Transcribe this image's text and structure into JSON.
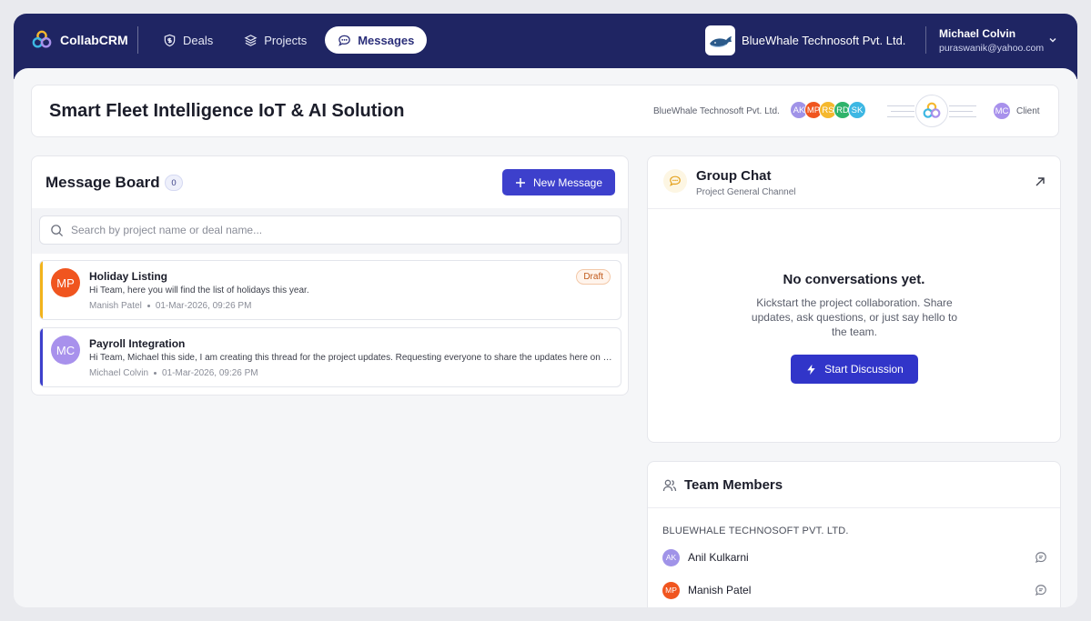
{
  "app": {
    "name": "CollabCRM"
  },
  "nav": {
    "deals": "Deals",
    "projects": "Projects",
    "messages": "Messages"
  },
  "company": {
    "name": "BlueWhale Technosoft Pvt. Ltd."
  },
  "user": {
    "name": "Michael Colvin",
    "email": "puraswanik@yahoo.com"
  },
  "project": {
    "title": "Smart Fleet Intelligence IoT & AI Solution",
    "company": "BlueWhale Technosoft Pvt. Ltd.",
    "avatars": [
      {
        "initials": "AK",
        "color": "#a093e8"
      },
      {
        "initials": "MP",
        "color": "#f0551f"
      },
      {
        "initials": "RS",
        "color": "#f5b82e"
      },
      {
        "initials": "RD",
        "color": "#2fb36b"
      },
      {
        "initials": "SK",
        "color": "#3db7e3"
      }
    ],
    "client": {
      "initials": "MC",
      "label": "Client",
      "color": "#a891ec"
    }
  },
  "board": {
    "title": "Message Board",
    "count": "0",
    "new_message_label": "New Message",
    "search_placeholder": "Search by project name or deal name...",
    "messages": [
      {
        "initials": "MP",
        "avatar_color": "#f0551f",
        "stripe_color": "#f2b31b",
        "title": "Holiday Listing",
        "body": "Hi Team, here you will find the list of holidays this year.",
        "author": "Manish Patel",
        "date": "01-Mar-2026, 09:26 PM",
        "badge": "Draft"
      },
      {
        "initials": "MC",
        "avatar_color": "#a891ec",
        "stripe_color": "#3d40cc",
        "title": "Payroll Integration",
        "body": "Hi Team, Michael this side, I am creating this thread for the project updates. Requesting everyone to share the updates here on a regular basis.",
        "author": "Michael Colvin",
        "date": "01-Mar-2026, 09:26 PM",
        "badge": ""
      }
    ]
  },
  "chat": {
    "title": "Group Chat",
    "subtitle": "Project General Channel",
    "empty_title": "No conversations yet.",
    "empty_desc": "Kickstart the project collaboration. Share updates, ask questions, or just say hello to the team.",
    "start_label": "Start Discussion"
  },
  "team": {
    "title": "Team Members",
    "org": "BLUEWHALE TECHNOSOFT PVT. LTD.",
    "members": [
      {
        "initials": "AK",
        "name": "Anil Kulkarni",
        "color": "#a093e8"
      },
      {
        "initials": "MP",
        "name": "Manish Patel",
        "color": "#f0551f"
      }
    ]
  },
  "icons": {
    "logo": "collabcrm-logo-icon",
    "deals": "shield-dollar-icon",
    "projects": "layers-icon",
    "messages": "chat-bubble-icon",
    "search": "search-icon",
    "plus": "plus-icon",
    "expand": "arrow-up-right-icon",
    "bolt": "bolt-icon",
    "team": "users-icon",
    "chevron": "chevron-down-icon"
  }
}
